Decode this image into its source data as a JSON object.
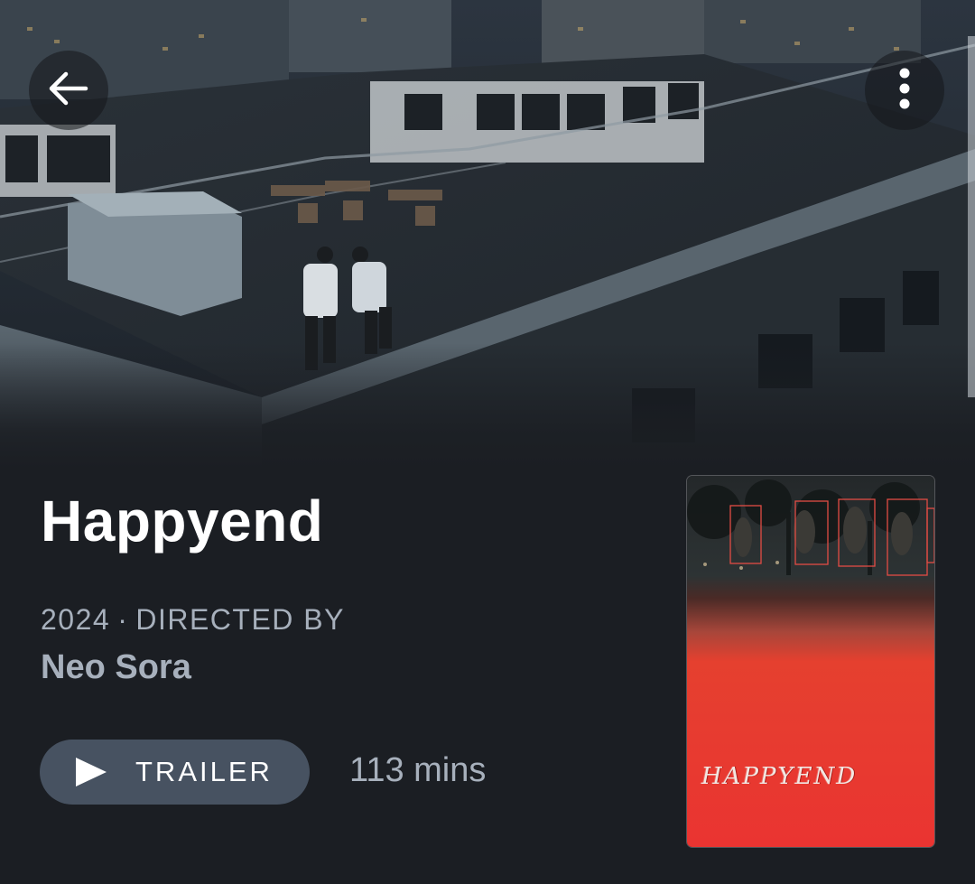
{
  "film": {
    "title": "Happyend",
    "year": "2024",
    "separator": "·",
    "directed_by_label": "DIRECTED BY",
    "director": "Neo Sora",
    "runtime": "113 mins"
  },
  "actions": {
    "trailer_label": "TRAILER"
  },
  "poster": {
    "title": "HAPPYEND"
  },
  "icons": {
    "back": "arrow-left-icon",
    "more": "more-vertical-icon",
    "play": "play-icon"
  },
  "colors": {
    "background": "#1b1e23",
    "button": "#475261",
    "muted_text": "#a7b0bc",
    "poster_red": "#e8332f"
  }
}
